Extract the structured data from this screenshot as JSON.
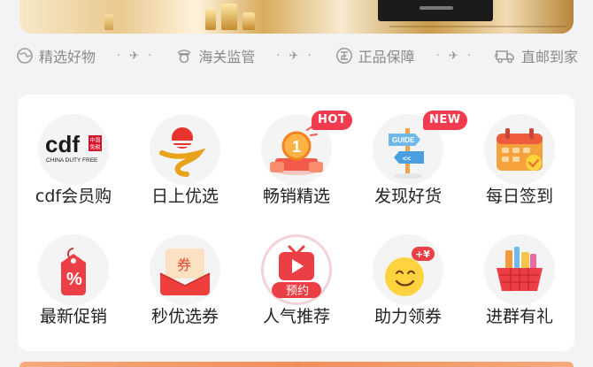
{
  "guarantees": [
    {
      "icon": "globe-icon",
      "label": "精选好物"
    },
    {
      "icon": "customs-officer-icon",
      "label": "海关监管"
    },
    {
      "icon": "authentic-seal-icon",
      "label": "正品保障"
    },
    {
      "icon": "delivery-truck-icon",
      "label": "直邮到家"
    }
  ],
  "separator": "· ✈ ·",
  "menu": [
    {
      "label": "cdf会员购",
      "icon": "cdf-logo-icon",
      "logo_text": "cdf",
      "logo_sub": "CHINA DUTY FREE",
      "logo_badge": "中国\n免税"
    },
    {
      "label": "日上优选",
      "icon": "sunrise-logo-icon"
    },
    {
      "label": "畅销精选",
      "icon": "medal-number-one-icon",
      "badge": "HOT",
      "medal_text": "1"
    },
    {
      "label": "发现好货",
      "icon": "guide-signpost-icon",
      "badge": "NEW",
      "sign_text": "GUIDE"
    },
    {
      "label": "每日签到",
      "icon": "calendar-checkin-icon"
    },
    {
      "label": "最新促销",
      "icon": "percent-tag-icon",
      "tag_text": "%"
    },
    {
      "label": "秒优选券",
      "icon": "coupon-envelope-icon",
      "coupon_text": "券"
    },
    {
      "label": "人气推荐",
      "icon": "tv-play-icon",
      "pill_text": "预约"
    },
    {
      "label": "助力领券",
      "icon": "smiley-plus-icon",
      "bubble_text": "+¥"
    },
    {
      "label": "进群有礼",
      "icon": "gift-basket-icon"
    }
  ],
  "colors": {
    "accent": "#f23b4e",
    "text": "#222222",
    "muted": "#8a8a8a"
  }
}
